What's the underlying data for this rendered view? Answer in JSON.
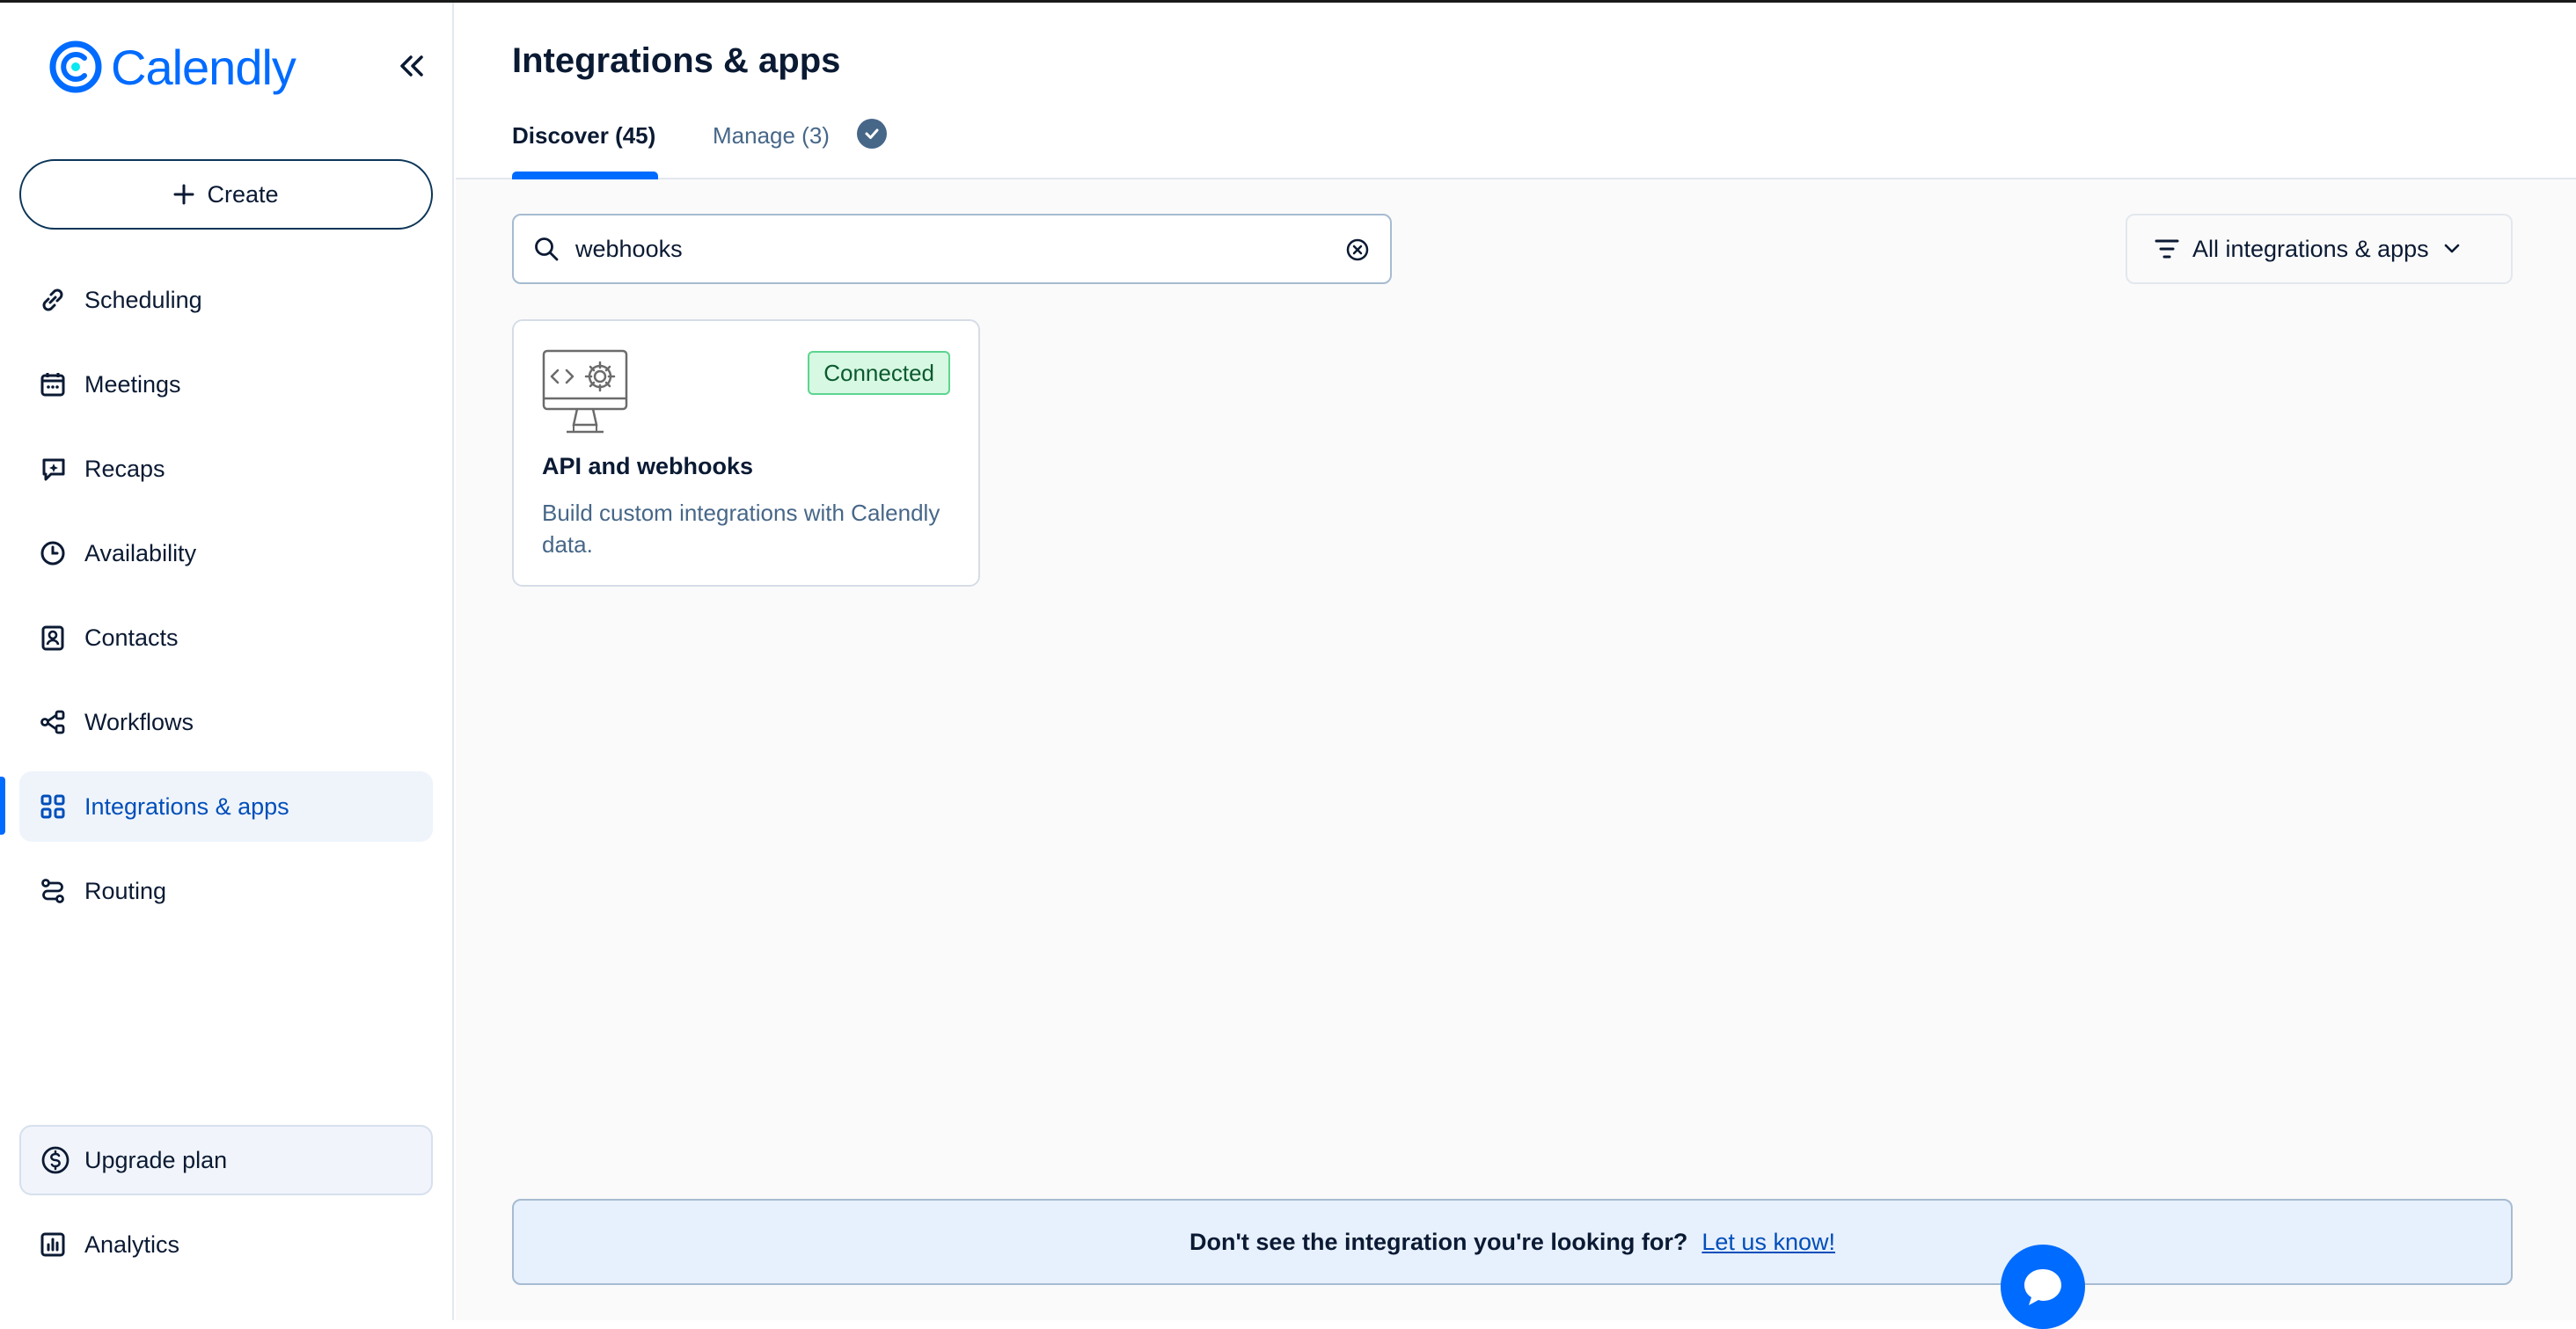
{
  "brand": {
    "name": "Calendly",
    "accent": "#006bff"
  },
  "sidebar": {
    "create_label": "Create",
    "items": [
      {
        "label": "Scheduling",
        "icon": "link-icon"
      },
      {
        "label": "Meetings",
        "icon": "calendar-icon"
      },
      {
        "label": "Recaps",
        "icon": "recaps-icon"
      },
      {
        "label": "Availability",
        "icon": "clock-icon"
      },
      {
        "label": "Contacts",
        "icon": "contact-card-icon"
      },
      {
        "label": "Workflows",
        "icon": "workflow-icon"
      },
      {
        "label": "Integrations & apps",
        "icon": "grid-icon",
        "active": true
      },
      {
        "label": "Routing",
        "icon": "routing-icon"
      }
    ],
    "upgrade_label": "Upgrade plan",
    "analytics_label": "Analytics"
  },
  "main": {
    "title": "Integrations & apps",
    "tabs": [
      {
        "label": "Discover (45)",
        "active": true
      },
      {
        "label": "Manage (3)"
      }
    ],
    "search": {
      "value": "webhooks",
      "placeholder": ""
    },
    "filter_label": "All integrations & apps",
    "cards": [
      {
        "title": "API and webhooks",
        "description": "Build custom integrations with Calendly data.",
        "status": "Connected"
      }
    ],
    "banner": {
      "text": "Don't see the integration you're looking for?",
      "link": "Let us know!"
    }
  }
}
